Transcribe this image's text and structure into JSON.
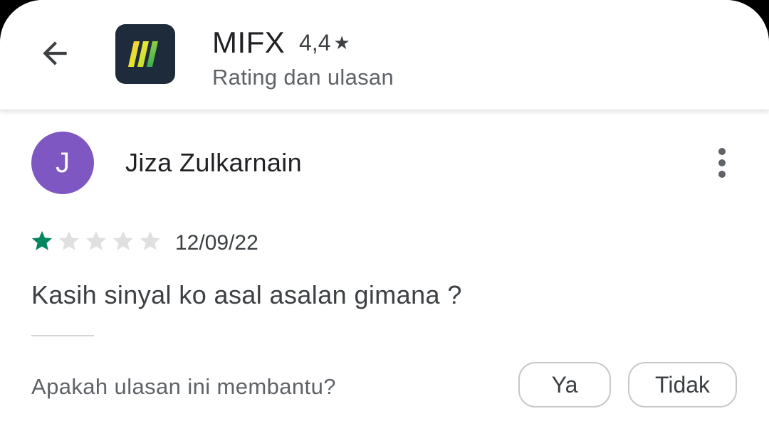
{
  "header": {
    "app_name": "MIFX",
    "rating": "4,4",
    "rating_star": "★",
    "subtitle": "Rating dan ulasan"
  },
  "review": {
    "avatar_initial": "J",
    "avatar_color": "#7e57c2",
    "reviewer_name": "Jiza Zulkarnain",
    "star_rating": 1,
    "star_max": 5,
    "date": "12/09/22",
    "text": "Kasih sinyal ko asal asalan gimana ?"
  },
  "helpful": {
    "question": "Apakah ulasan ini membantu?",
    "yes_label": "Ya",
    "no_label": "Tidak"
  },
  "colors": {
    "star_filled": "#01875f",
    "star_empty": "#e0e0e0",
    "app_icon_bg": "#1d2b3a"
  }
}
